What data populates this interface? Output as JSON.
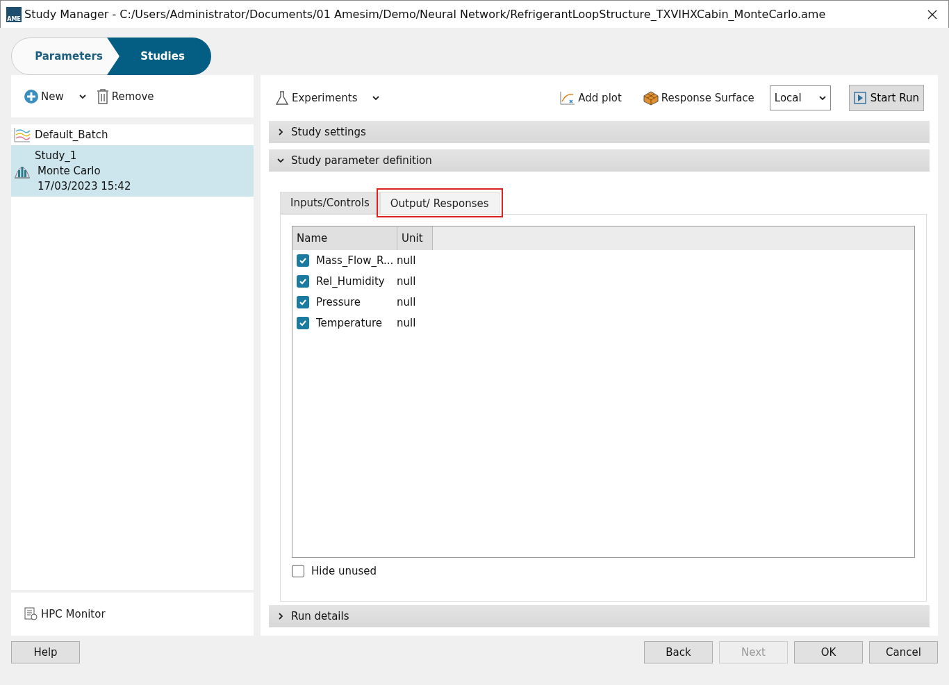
{
  "window": {
    "logo_text": "AME",
    "title": "Study Manager - C:/Users/Administrator/Documents/01 Amesim/Demo/Neural Network/RefrigerantLoopStructure_TXVIHXCabin_MonteCarlo.ame"
  },
  "steps": [
    {
      "label": "Parameters",
      "selected": false
    },
    {
      "label": "Studies",
      "selected": true
    }
  ],
  "sidebar": {
    "toolbar": [
      "New",
      "Remove"
    ],
    "items": [
      {
        "kind": "batch",
        "lines": [
          "Default_Batch"
        ],
        "selected": false
      },
      {
        "kind": "study",
        "lines": [
          "Study_1",
          "Monte Carlo",
          "17/03/2023 15:42"
        ],
        "selected": true
      }
    ],
    "footer": "HPC Monitor"
  },
  "toolbar": {
    "experiments": "Experiments",
    "add_plot": "Add plot",
    "response_surface": "Response Surface",
    "location": "Local",
    "start": "Start Run"
  },
  "sections": [
    {
      "title": "Study settings",
      "expanded": false
    },
    {
      "title": "Study parameter definition",
      "expanded": true
    }
  ],
  "tabs": [
    {
      "label": "Inputs/Controls",
      "selected": false,
      "highlighted": false
    },
    {
      "label": "Output/ Responses",
      "selected": true,
      "highlighted": true
    }
  ],
  "table": {
    "columns": [
      "Name",
      "Unit"
    ],
    "rows": [
      {
        "name": "Mass_Flow_R...",
        "unit": "null",
        "checked": true
      },
      {
        "name": "Rel_Humidity",
        "unit": "null",
        "checked": true
      },
      {
        "name": "Pressure",
        "unit": "null",
        "checked": true
      },
      {
        "name": "Temperature",
        "unit": "null",
        "checked": true
      }
    ]
  },
  "hide_unused": {
    "label": "Hide unused",
    "checked": false
  },
  "run_details": {
    "title": "Run details",
    "expanded": false
  },
  "buttons": [
    {
      "label": "Help",
      "disabled": false
    },
    {
      "label": "Back",
      "disabled": false
    },
    {
      "label": "Next",
      "disabled": true
    },
    {
      "label": "OK",
      "disabled": false
    },
    {
      "label": "Cancel",
      "disabled": false
    }
  ]
}
